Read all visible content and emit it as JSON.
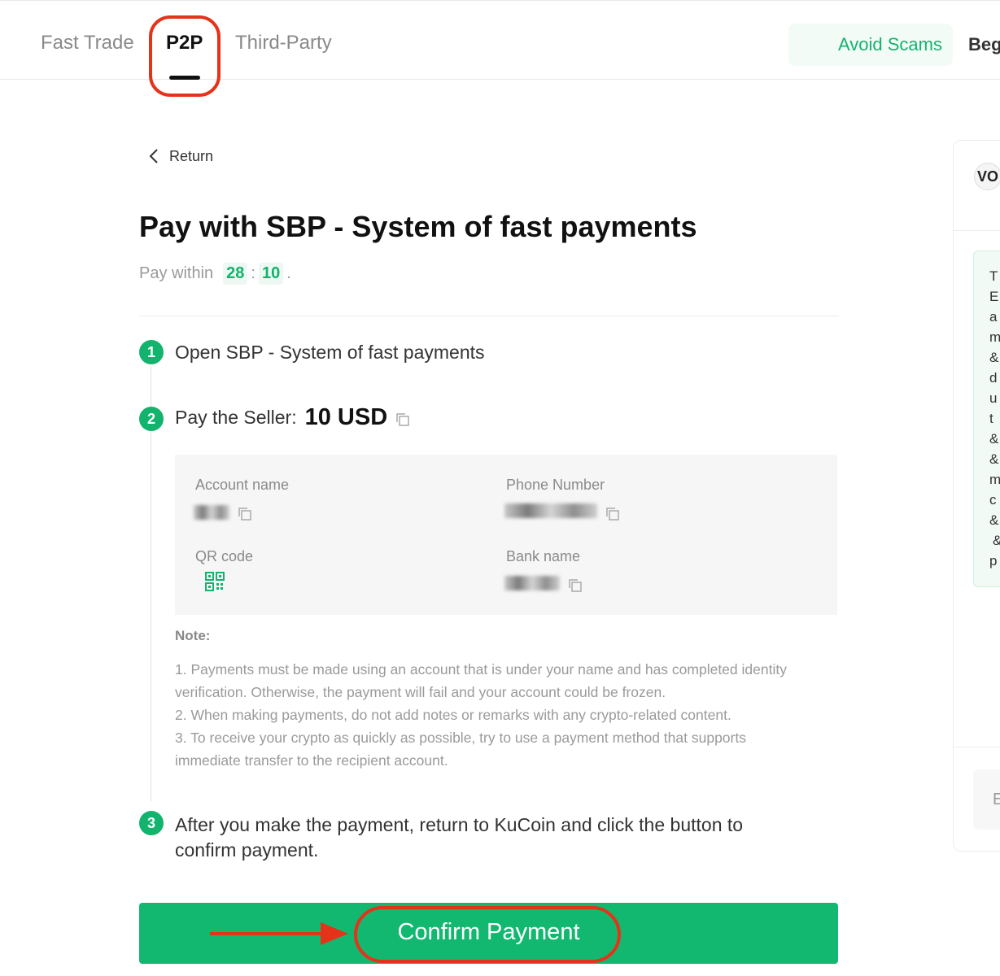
{
  "nav": {
    "tabs": [
      "Fast Trade",
      "P2P",
      "Third-Party"
    ],
    "active_tab": "P2P",
    "avoid_scams": "Avoid Scams",
    "cut_link": "Beg"
  },
  "return_label": "Return",
  "title": "Pay with SBP - System of fast payments",
  "pay_within": {
    "label": "Pay within",
    "minutes": "28",
    "separator": ":",
    "seconds": "10",
    "end": "."
  },
  "steps": {
    "s1": {
      "num": "1",
      "text": "Open SBP - System of fast payments"
    },
    "s2": {
      "num": "2",
      "text": "Pay the Seller:",
      "amount": "10 USD"
    },
    "s3": {
      "num": "3",
      "line1": "After you make the payment, return to KuCoin and click the button to",
      "line2": "confirm payment."
    }
  },
  "payment_details": {
    "account_name_label": "Account name",
    "phone_number_label": "Phone Number",
    "qr_code_label": "QR code",
    "bank_name_label": "Bank name"
  },
  "note": {
    "title": "Note:",
    "lines": [
      "1. Payments must be made using an account that is under your name and has completed identity",
      "verification. Otherwise, the payment will fail and your account could be frozen.",
      "2. When making payments, do not add notes or remarks with any crypto-related content.",
      "3. To receive your crypto as quickly as possible, try to use a payment method that supports",
      "immediate transfer to the recipient account."
    ]
  },
  "confirm_button": "Confirm Payment",
  "right_panel": {
    "avatar_text": "VO",
    "chat_chars": [
      "T",
      "E",
      "a",
      "m",
      "&",
      "d",
      "u",
      "t",
      "&",
      "&",
      "m",
      "c",
      "&",
      "&",
      "p"
    ],
    "input_char": "E"
  },
  "colors": {
    "brand_green": "#12b86f",
    "highlight_red": "#e5331a"
  }
}
